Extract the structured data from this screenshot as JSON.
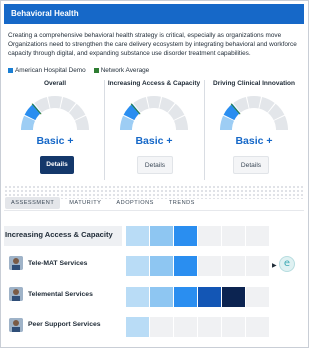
{
  "header": {
    "title": "Behavioral Health"
  },
  "description": "Creating a comprehensive behavioral health strategy is critical, especially as organizations move Organizations need to strengthen the care delivery ecosystem by integrating behavioral and workforce capacity through digital, and expanding substance use disorder treatment capabilities.",
  "legend": [
    {
      "label": "American Hospital Demo",
      "color": "#1a7fd4"
    },
    {
      "label": "Network Average",
      "color": "#2e7d32"
    }
  ],
  "gauges": [
    {
      "title": "Overall",
      "level": "Basic +",
      "button": "Details",
      "filled_segments": 2,
      "total_segments": 7
    },
    {
      "title": "Increasing Access & Capacity",
      "level": "Basic +",
      "button": "Details",
      "filled_segments": 2,
      "total_segments": 7
    },
    {
      "title": "Driving Clinical Innovation",
      "level": "Basic +",
      "button": "Details",
      "filled_segments": 2,
      "total_segments": 7
    }
  ],
  "tabs": [
    "ASSESSMENT",
    "MATURITY",
    "ADOPTIONS",
    "TRENDS"
  ],
  "category": {
    "label": "Increasing Access & Capacity",
    "cells": [
      "#b9dcf6",
      "#8ec6f2",
      "#2a8ef0",
      "#f0f1f3",
      "#f0f1f3",
      "#f0f1f3"
    ]
  },
  "services": [
    {
      "label": "Tele-MAT Services",
      "cells": [
        "#b9dcf6",
        "#8ec6f2",
        "#2a8ef0",
        "#f0f1f3",
        "#f0f1f3",
        "#f0f1f3"
      ]
    },
    {
      "label": "Telemental Services",
      "cells": [
        "#b9dcf6",
        "#8ec6f2",
        "#2a8ef0",
        "#1356b5",
        "#0c2451",
        "#f0f1f3"
      ]
    },
    {
      "label": "Peer Support Services",
      "cells": [
        "#b9dcf6",
        "#f0f1f3",
        "#f0f1f3",
        "#f0f1f3",
        "#f0f1f3",
        "#f0f1f3"
      ]
    }
  ],
  "badge": {
    "letter": "e",
    "arrow": "▶"
  }
}
